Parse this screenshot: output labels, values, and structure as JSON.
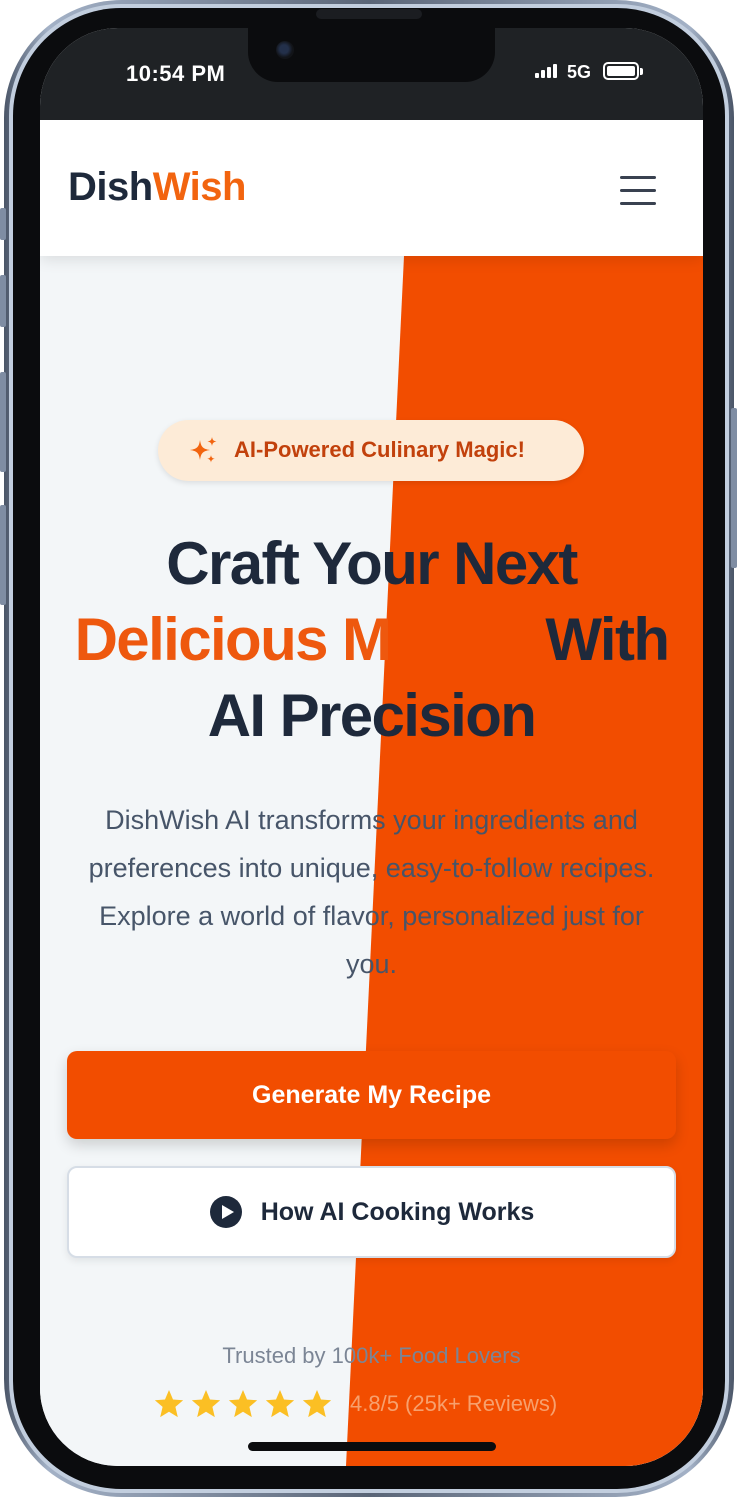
{
  "status_bar": {
    "time": "10:54 PM",
    "network": "5G",
    "icons": [
      "signal-icon",
      "battery-icon"
    ]
  },
  "header": {
    "brand_primary": "Dish",
    "brand_accent": "Wish",
    "menu_icon": "hamburger-menu-icon"
  },
  "hero": {
    "badge": {
      "icon": "sparkles-icon",
      "label": "AI-Powered Culinary Magic!"
    },
    "title_line1": "Craft Your Next",
    "title_highlight": "Delicious M",
    "title_line2_rest": "With",
    "title_line3": "AI Precision",
    "description": "DishWish AI transforms your ingredients and preferences into unique, easy-to-follow recipes. Explore a world of flavor, personalized just for you.",
    "primary_button": "Generate My Recipe",
    "secondary_button": {
      "icon": "play-icon",
      "label": "How AI Cooking Works"
    },
    "trust_text": "Trusted by 100k+ Food Lovers",
    "rating": {
      "stars": 5,
      "text": "4.8/5 (25k+ Reviews)"
    }
  },
  "colors": {
    "brand_dark": "#1e293b",
    "brand_orange": "#f2640f",
    "hero_accent_band": "#f24d00",
    "badge_bg": "#fdebd7",
    "star": "#fbbf24",
    "hero_bg": "#f3f6f8"
  }
}
